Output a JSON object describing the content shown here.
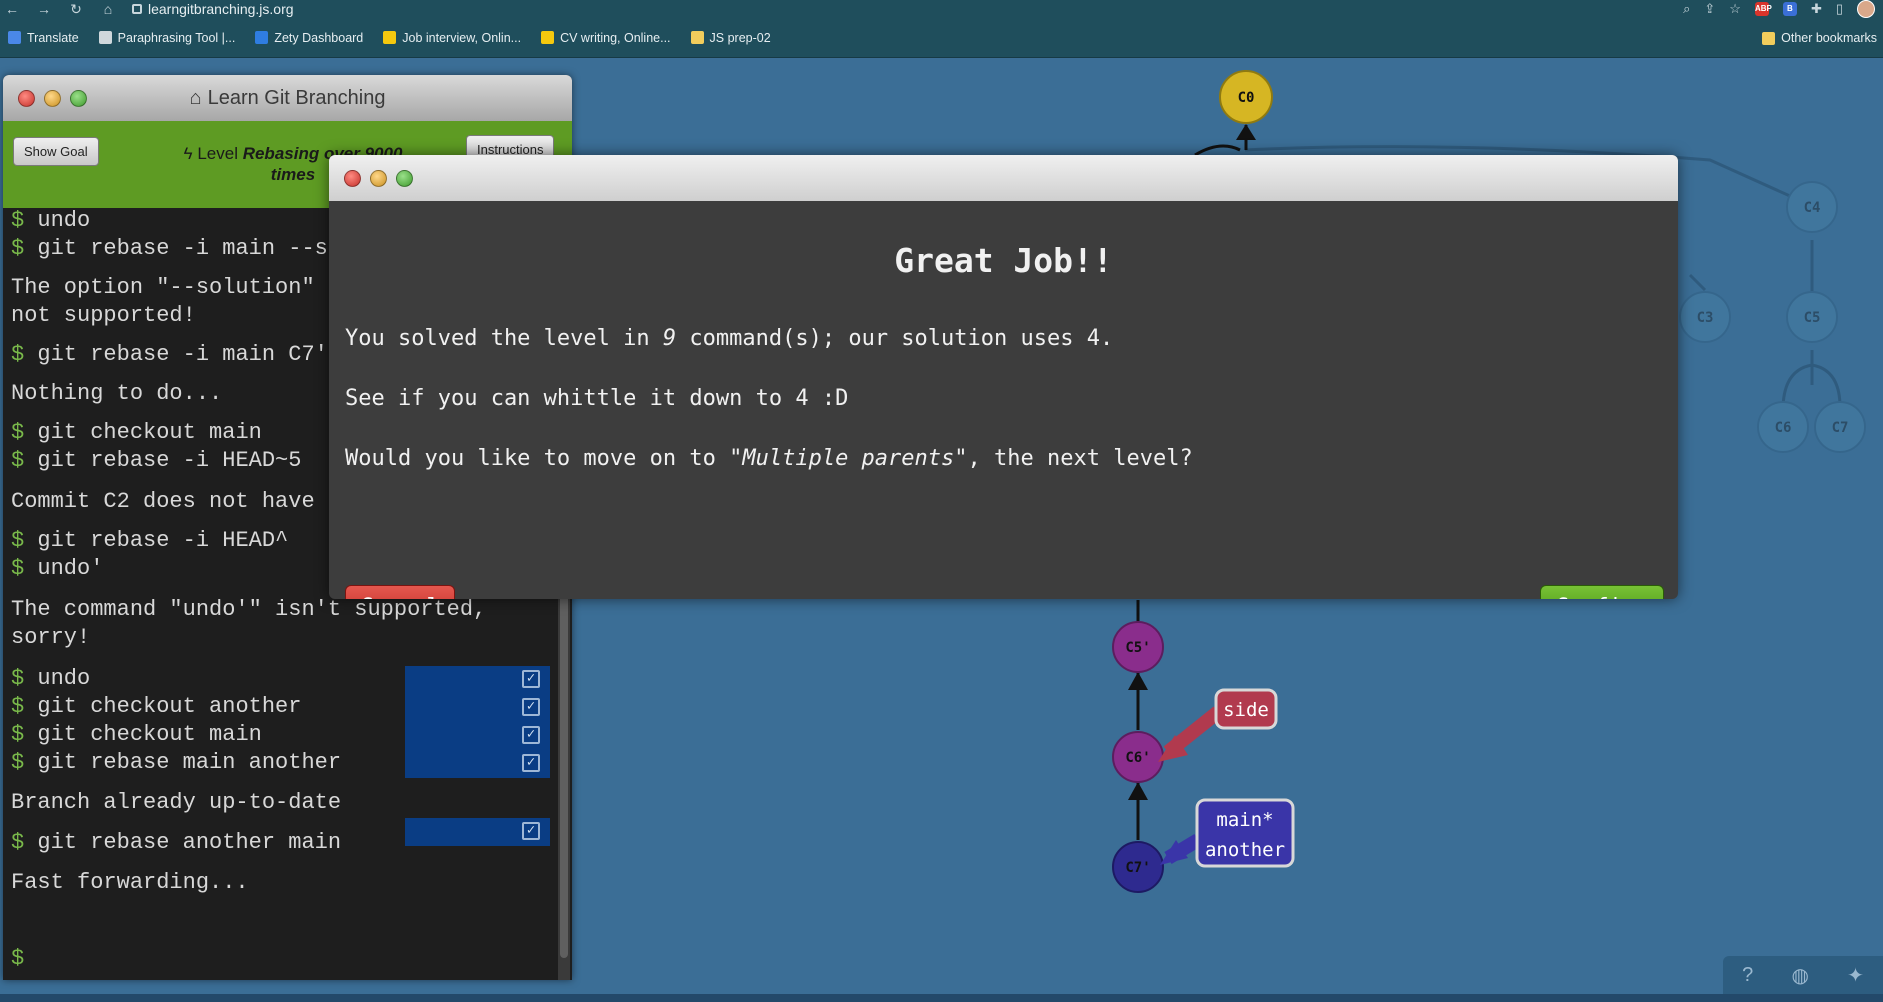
{
  "browser": {
    "url": "learngitbranching.js.org",
    "bookmarks": [
      {
        "label": "Translate",
        "color": "#4a88e8"
      },
      {
        "label": "Paraphrasing Tool |...",
        "color": "#cfd8dc"
      },
      {
        "label": "Zety Dashboard",
        "color": "#2f7de1"
      },
      {
        "label": "Job interview, Onlin...",
        "color": "#f6c90e"
      },
      {
        "label": "CV writing, Online...",
        "color": "#f6c90e"
      },
      {
        "label": "JS prep-02",
        "color": "#f2cd5c"
      }
    ],
    "other_bookmarks": "Other bookmarks",
    "ext_abp": "ABP",
    "ext_b": "B"
  },
  "terminal": {
    "title": "Learn Git Branching",
    "show_goal": "Show Goal",
    "instructions": "Instructions",
    "level_prefix": "Level",
    "level_name": "Rebasing over 9000 times",
    "prompt_symbol": "$",
    "lines": [
      {
        "type": "cmd",
        "text": "undo"
      },
      {
        "type": "cmd",
        "text": "git rebase -i main --s"
      },
      {
        "type": "out",
        "text": "The option \"--solution\""
      },
      {
        "type": "out",
        "text": "not supported!"
      },
      {
        "type": "cmd",
        "text": "git rebase -i main C7'"
      },
      {
        "type": "out",
        "text": "Nothing to do..."
      },
      {
        "type": "cmd",
        "text": "git checkout main"
      },
      {
        "type": "cmd",
        "text": "git rebase -i HEAD~5"
      },
      {
        "type": "out",
        "text": "Commit C2 does not have"
      },
      {
        "type": "cmd",
        "text": "git rebase -i HEAD^"
      },
      {
        "type": "cmd",
        "text": "undo'"
      },
      {
        "type": "out",
        "text": "The command \"undo'\" isn't supported,"
      },
      {
        "type": "out",
        "text": "sorry!"
      },
      {
        "type": "cmd",
        "text": "undo"
      },
      {
        "type": "cmd",
        "text": "git checkout another"
      },
      {
        "type": "cmd",
        "text": "git checkout main"
      },
      {
        "type": "cmd",
        "text": "git rebase main another"
      },
      {
        "type": "out",
        "text": "Branch already up-to-date"
      },
      {
        "type": "cmd",
        "text": "git rebase another main"
      },
      {
        "type": "out",
        "text": "Fast forwarding..."
      }
    ]
  },
  "modal": {
    "heading": "Great Job!!",
    "line1_a": "You solved the level in ",
    "line1_count": "9",
    "line1_b": " command(s); our solution uses 4.",
    "line2": "See if you can whittle it down to 4 :D",
    "line3_a": "Would you like to move on to ",
    "line3_level": "\"Multiple parents\"",
    "line3_b": ", the next level?",
    "cancel": "Cancel",
    "confirm": "Confirm"
  },
  "graph": {
    "nodes": [
      "C0",
      "C3",
      "C4",
      "C5",
      "C6",
      "C7",
      "C5'",
      "C6'",
      "C7'"
    ],
    "branches": {
      "side": "side",
      "main": "main*",
      "another": "another"
    },
    "colors": {
      "main": "#2e2a8f",
      "side": "#b13a4e",
      "c0": "#d6b623",
      "ghost": "#4b86ab"
    }
  }
}
